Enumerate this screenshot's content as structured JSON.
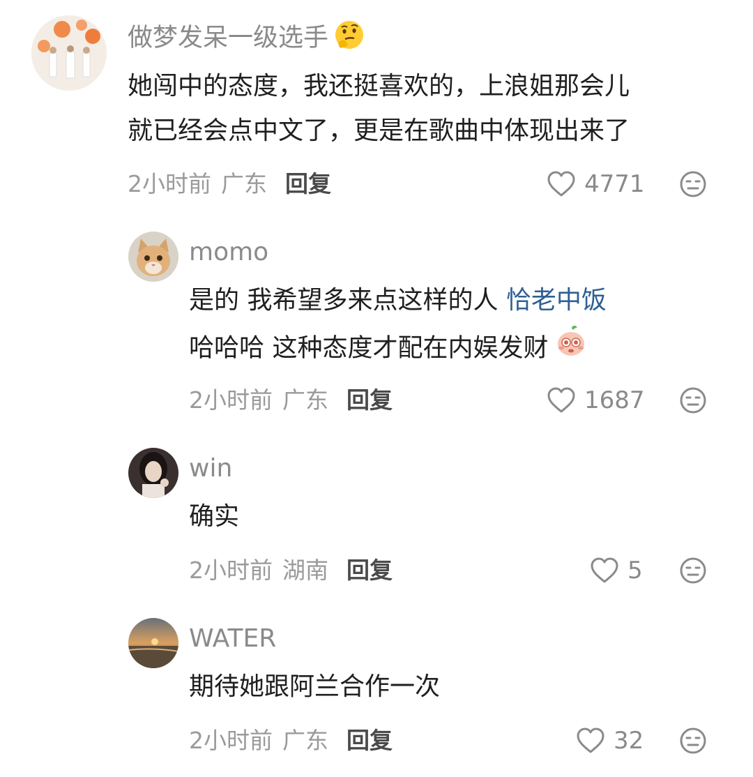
{
  "comments": [
    {
      "username": "做梦发呆一级选手",
      "username_emoji": "thinking-face-emoji",
      "lines": [
        "她闯中的态度，我还挺喜欢的，上浪姐那会儿",
        "就已经会点中文了，更是在歌曲中体现出来了"
      ],
      "time": "2小时前",
      "location": "广东",
      "reply_label": "回复",
      "likes": "4771"
    },
    {
      "username": "momo",
      "line1_text": "是的 我希望多来点这样的人 ",
      "line1_link": "恰老中饭",
      "line2_text": "哈哈哈 这种态度才配在内娱发财",
      "line2_emoji": "peach-baby-emoji",
      "time": "2小时前",
      "location": "广东",
      "reply_label": "回复",
      "likes": "1687"
    },
    {
      "username": "win",
      "lines": [
        "确实"
      ],
      "time": "2小时前",
      "location": "湖南",
      "reply_label": "回复",
      "likes": "5"
    },
    {
      "username": "WATER",
      "lines": [
        "期待她跟阿兰合作一次"
      ],
      "time": "2小时前",
      "location": "广东",
      "reply_label": "回复",
      "likes": "32"
    }
  ],
  "icons": {
    "like": "heart-outline-icon",
    "dislike": "neutral-face-icon"
  },
  "colors": {
    "link": "#2f5f94",
    "meta": "#9a9a9a",
    "username": "#8a8a8a"
  }
}
